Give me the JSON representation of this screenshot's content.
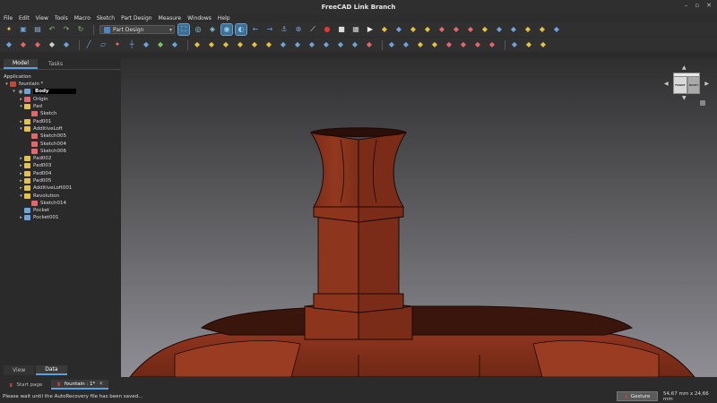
{
  "window": {
    "title": "FreeCAD Link Branch",
    "controls": [
      "–",
      "▫",
      "✕"
    ]
  },
  "menu": [
    "File",
    "Edit",
    "View",
    "Tools",
    "Macro",
    "Sketch",
    "Part Design",
    "Measure",
    "Windows",
    "Help"
  ],
  "toolbar1": {
    "workbench": "Part Design",
    "icons_before": [
      {
        "name": "new-document-icon",
        "glyph": "✦",
        "color": "#e3c14a"
      },
      {
        "name": "open-icon",
        "glyph": "▣",
        "color": "#6fa3d9"
      },
      {
        "name": "save-icon",
        "glyph": "▤",
        "color": "#8fb0d8"
      },
      {
        "name": "undo-icon",
        "glyph": "↶",
        "color": "#79c16a"
      },
      {
        "name": "redo-icon",
        "glyph": "↷",
        "color": "#79c16a"
      },
      {
        "name": "refresh-icon",
        "glyph": "↻",
        "color": "#79c16a"
      }
    ],
    "icons_after": [
      {
        "name": "fit-all-icon",
        "glyph": "⛶",
        "color": "#8fd0e8",
        "active": true
      },
      {
        "name": "fit-selection-icon",
        "glyph": "◎",
        "color": "#8fd0e8"
      },
      {
        "name": "draw-style-icon",
        "glyph": "◈",
        "color": "#8fd0e8"
      },
      {
        "name": "bounding-box-icon",
        "glyph": "◉",
        "color": "#8fd0e8",
        "active": true
      },
      {
        "name": "stereo-icon",
        "glyph": "◐",
        "color": "#8fd0e8",
        "active": true
      },
      {
        "name": "back-icon",
        "glyph": "←",
        "color": "#6fa3d9"
      },
      {
        "name": "forward-icon",
        "glyph": "→",
        "color": "#6fa3d9"
      },
      {
        "name": "link-icon",
        "glyph": "⚓",
        "color": "#6fa3d9"
      },
      {
        "name": "link-group-icon",
        "glyph": "⊗",
        "color": "#6fa3d9"
      },
      {
        "name": "measure-icon",
        "glyph": "⟋",
        "color": "#e8e8e8"
      },
      {
        "name": "record-macro-icon",
        "glyph": "●",
        "color": "#e03a2f"
      },
      {
        "name": "stop-macro-icon",
        "glyph": "■",
        "color": "#dddddd"
      },
      {
        "name": "macros-icon",
        "glyph": "▦",
        "color": "#d0d0d0"
      },
      {
        "name": "execute-macro-icon",
        "glyph": "▶",
        "color": "#f0f0f0"
      },
      {
        "name": "part-tool-icon",
        "glyph": "◆",
        "color": "#e3c14a"
      },
      {
        "name": "body-tool-icon",
        "glyph": "◆",
        "color": "#6fa3d9"
      },
      {
        "name": "sketch-tool-icon",
        "glyph": "◆",
        "color": "#e3c14a"
      },
      {
        "name": "clone-icon",
        "glyph": "◆",
        "color": "#e3c14a"
      },
      {
        "name": "binder-icon",
        "glyph": "◆",
        "color": "#e06a6a"
      },
      {
        "name": "subshape-icon",
        "glyph": "◆",
        "color": "#e06a6a"
      },
      {
        "name": "datum-icon",
        "glyph": "◆",
        "color": "#e06a6a"
      },
      {
        "name": "plane-icon",
        "glyph": "◆",
        "color": "#e3c14a"
      },
      {
        "name": "line-icon",
        "glyph": "◆",
        "color": "#6fa3d9"
      },
      {
        "name": "point-icon",
        "glyph": "◆",
        "color": "#6fa3d9"
      },
      {
        "name": "cs-icon",
        "glyph": "◆",
        "color": "#e3c14a"
      },
      {
        "name": "shape-binder-icon",
        "glyph": "◆",
        "color": "#e3c14a"
      },
      {
        "name": "flip-icon",
        "glyph": "◆",
        "color": "#6fa3d9"
      }
    ]
  },
  "toolbar2": {
    "icons": [
      {
        "name": "create-body-icon",
        "glyph": "◆",
        "color": "#6fa3d9"
      },
      {
        "name": "create-sketch-icon",
        "glyph": "◆",
        "color": "#e06a6a"
      },
      {
        "name": "validate-sketch-icon",
        "glyph": "◆",
        "color": "#e06a6a"
      },
      {
        "name": "import-icon",
        "glyph": "◆",
        "color": "#d0d0d0"
      },
      {
        "name": "part-icon",
        "glyph": "◆",
        "color": "#6fa3d9"
      },
      {
        "name": "line-tool-icon",
        "glyph": "╱",
        "color": "#6fa3d9"
      },
      {
        "name": "plane-tool-icon",
        "glyph": "▱",
        "color": "#6fa3d9"
      },
      {
        "name": "point-tool-icon",
        "glyph": "✦",
        "color": "#e06a6a"
      },
      {
        "name": "cs-tool-icon",
        "glyph": "┼",
        "color": "#6fa3d9"
      },
      {
        "name": "shape-binder-tool-icon",
        "glyph": "◆",
        "color": "#6fa3d9"
      },
      {
        "name": "subshape-binder-icon",
        "glyph": "◆",
        "color": "#79c16a"
      },
      {
        "name": "clone-tool-icon",
        "glyph": "◆",
        "color": "#6fa3d9"
      },
      {
        "name": "pad-icon",
        "glyph": "◆",
        "color": "#e3c14a"
      },
      {
        "name": "revolution-icon",
        "glyph": "◆",
        "color": "#e3c14a"
      },
      {
        "name": "loft-icon",
        "glyph": "◆",
        "color": "#e3c14a"
      },
      {
        "name": "pipe-icon",
        "glyph": "◆",
        "color": "#e3c14a"
      },
      {
        "name": "helix-icon",
        "glyph": "◆",
        "color": "#e3c14a"
      },
      {
        "name": "additive-box-icon",
        "glyph": "◆",
        "color": "#e3c14a"
      },
      {
        "name": "pocket-icon",
        "glyph": "◆",
        "color": "#6fa3d9"
      },
      {
        "name": "hole-icon",
        "glyph": "◆",
        "color": "#6fa3d9"
      },
      {
        "name": "groove-icon",
        "glyph": "◆",
        "color": "#6fa3d9"
      },
      {
        "name": "subtractive-loft-icon",
        "glyph": "◆",
        "color": "#6fa3d9"
      },
      {
        "name": "subtractive-pipe-icon",
        "glyph": "◆",
        "color": "#6fa3d9"
      },
      {
        "name": "subtractive-helix-icon",
        "glyph": "◆",
        "color": "#6fa3d9"
      },
      {
        "name": "subtractive-box-icon",
        "glyph": "◆",
        "color": "#e06a6a"
      },
      {
        "name": "fillet-icon",
        "glyph": "◆",
        "color": "#6fa3d9"
      },
      {
        "name": "chamfer-icon",
        "glyph": "◆",
        "color": "#6fa3d9"
      },
      {
        "name": "draft-icon",
        "glyph": "◆",
        "color": "#e3c14a"
      },
      {
        "name": "thickness-icon",
        "glyph": "◆",
        "color": "#e3c14a"
      },
      {
        "name": "mirrored-icon",
        "glyph": "◆",
        "color": "#e06a6a"
      },
      {
        "name": "linear-pattern-icon",
        "glyph": "◆",
        "color": "#e06a6a"
      },
      {
        "name": "polar-pattern-icon",
        "glyph": "◆",
        "color": "#e06a6a"
      },
      {
        "name": "multitransform-icon",
        "glyph": "◆",
        "color": "#e06a6a"
      },
      {
        "name": "boolean-icon",
        "glyph": "◆",
        "color": "#6fa3d9"
      },
      {
        "name": "wrap-icon",
        "glyph": "◆",
        "color": "#e3c14a"
      },
      {
        "name": "tool-extra-icon",
        "glyph": "◆",
        "color": "#e3c14a"
      }
    ]
  },
  "panel": {
    "tabs": [
      "Model",
      "Tasks"
    ],
    "active_tab": "Model",
    "application_label": "Application",
    "bottom_tabs": [
      "View",
      "Data"
    ],
    "active_bottom_tab": "Data"
  },
  "tree": [
    {
      "label": "fountain *",
      "level": 0,
      "arrow": "▾",
      "icon": "#c04a3a",
      "eye": ""
    },
    {
      "label": "Body",
      "level": 1,
      "arrow": "▾",
      "icon": "#6fa3d9",
      "eye": "👁",
      "selected": true
    },
    {
      "label": "Origin",
      "level": 2,
      "arrow": "▸",
      "icon": "#e06a6a",
      "eye": ""
    },
    {
      "label": "Pad",
      "level": 2,
      "arrow": "▾",
      "icon": "#e3c14a",
      "eye": ""
    },
    {
      "label": "Sketch",
      "level": 3,
      "arrow": "",
      "icon": "#e06a6a",
      "eye": ""
    },
    {
      "label": "Pad001",
      "level": 2,
      "arrow": "▸",
      "icon": "#e3c14a",
      "eye": ""
    },
    {
      "label": "AdditiveLoft",
      "level": 2,
      "arrow": "▾",
      "icon": "#e3c14a",
      "eye": ""
    },
    {
      "label": "Sketch005",
      "level": 3,
      "arrow": "",
      "icon": "#e06a6a",
      "eye": ""
    },
    {
      "label": "Sketch004",
      "level": 3,
      "arrow": "",
      "icon": "#e06a6a",
      "eye": ""
    },
    {
      "label": "Sketch006",
      "level": 3,
      "arrow": "",
      "icon": "#e06a6a",
      "eye": ""
    },
    {
      "label": "Pad002",
      "level": 2,
      "arrow": "▸",
      "icon": "#e3c14a",
      "eye": ""
    },
    {
      "label": "Pad003",
      "level": 2,
      "arrow": "▸",
      "icon": "#e3c14a",
      "eye": ""
    },
    {
      "label": "Pad004",
      "level": 2,
      "arrow": "▸",
      "icon": "#e3c14a",
      "eye": ""
    },
    {
      "label": "Pad005",
      "level": 2,
      "arrow": "▸",
      "icon": "#e3c14a",
      "eye": ""
    },
    {
      "label": "AdditiveLoft001",
      "level": 2,
      "arrow": "▸",
      "icon": "#e3c14a",
      "eye": ""
    },
    {
      "label": "Revolution",
      "level": 2,
      "arrow": "▾",
      "icon": "#e3c14a",
      "eye": ""
    },
    {
      "label": "Sketch014",
      "level": 3,
      "arrow": "",
      "icon": "#e06a6a",
      "eye": ""
    },
    {
      "label": "Pocket",
      "level": 2,
      "arrow": "",
      "icon": "#6fa3d9",
      "eye": ""
    },
    {
      "label": "Pocket001",
      "level": 2,
      "arrow": "▸",
      "icon": "#6fa3d9",
      "eye": ""
    }
  ],
  "navcube": {
    "front": "FRONT",
    "right": "RIGHT"
  },
  "doc_tabs": [
    {
      "label": "Start page",
      "active": false
    },
    {
      "label": "fountain : 1*",
      "active": true
    }
  ],
  "status": {
    "message": "Please wait until the AutoRecovery file has been saved...",
    "nav_style": "Gesture",
    "dimensions": "54,67 mm x 24,66 mm"
  },
  "colors": {
    "model": "#8f3520",
    "model_dark": "#3a150c",
    "accent": "#5aa0e0"
  }
}
